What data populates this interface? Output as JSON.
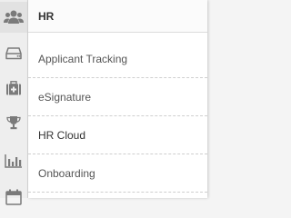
{
  "rail": {
    "items": [
      {
        "icon": "users-icon",
        "active": true
      },
      {
        "icon": "inbox-tray-icon",
        "active": false
      },
      {
        "icon": "medical-kit-icon",
        "active": false
      },
      {
        "icon": "trophy-icon",
        "active": false
      },
      {
        "icon": "bar-chart-icon",
        "active": false
      },
      {
        "icon": "calendar-icon",
        "active": false
      }
    ]
  },
  "flyout": {
    "title": "HR",
    "items": [
      {
        "label": "Applicant Tracking"
      },
      {
        "label": "eSignature"
      },
      {
        "label": "HR Cloud"
      },
      {
        "label": "Onboarding"
      }
    ]
  },
  "colors": {
    "icon": "#7a7a7a",
    "rail_bg": "#eeeeee",
    "flyout_bg": "#ffffff",
    "text": "#555555",
    "title": "#333333"
  }
}
